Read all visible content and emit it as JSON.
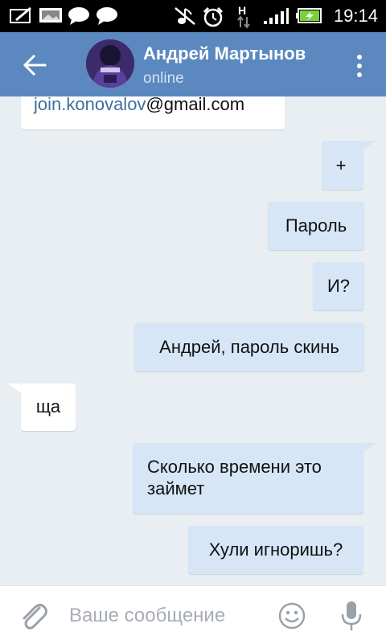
{
  "status_bar": {
    "time": "19:14",
    "network_label": "H",
    "icons": [
      "edit-note-icon",
      "image-icon",
      "chat-bubble-icon",
      "chat-bubble-icon",
      "muted-icon",
      "alarm-icon",
      "network-h-icon",
      "signal-icon",
      "battery-charging-icon"
    ]
  },
  "header": {
    "contact_name": "Андрей Мартынов",
    "status": "online",
    "back_icon": "arrow-left-icon",
    "menu_icon": "more-vertical-icon",
    "header_color": "#5b88bf"
  },
  "messages": [
    {
      "direction": "incoming",
      "link_text": "join.konovalov",
      "text_after_link": "@gmail.com"
    },
    {
      "direction": "outgoing",
      "text": "+"
    },
    {
      "direction": "outgoing",
      "text": "Пароль"
    },
    {
      "direction": "outgoing",
      "text": "И?"
    },
    {
      "direction": "outgoing",
      "text": "Андрей, пароль скинь"
    },
    {
      "direction": "incoming",
      "text": "ща"
    },
    {
      "direction": "outgoing",
      "line1": "Сколько времени это",
      "line2": "займет"
    },
    {
      "direction": "outgoing",
      "text": "Хули игноришь?"
    }
  ],
  "composer": {
    "placeholder": "Ваше сообщение",
    "value": "",
    "attach_icon": "paperclip-icon",
    "emoji_icon": "smiley-icon",
    "mic_icon": "microphone-icon"
  },
  "colors": {
    "incoming_bubble": "#ffffff",
    "outgoing_bubble": "#d6e6f7",
    "chat_background": "#e9eef3"
  }
}
